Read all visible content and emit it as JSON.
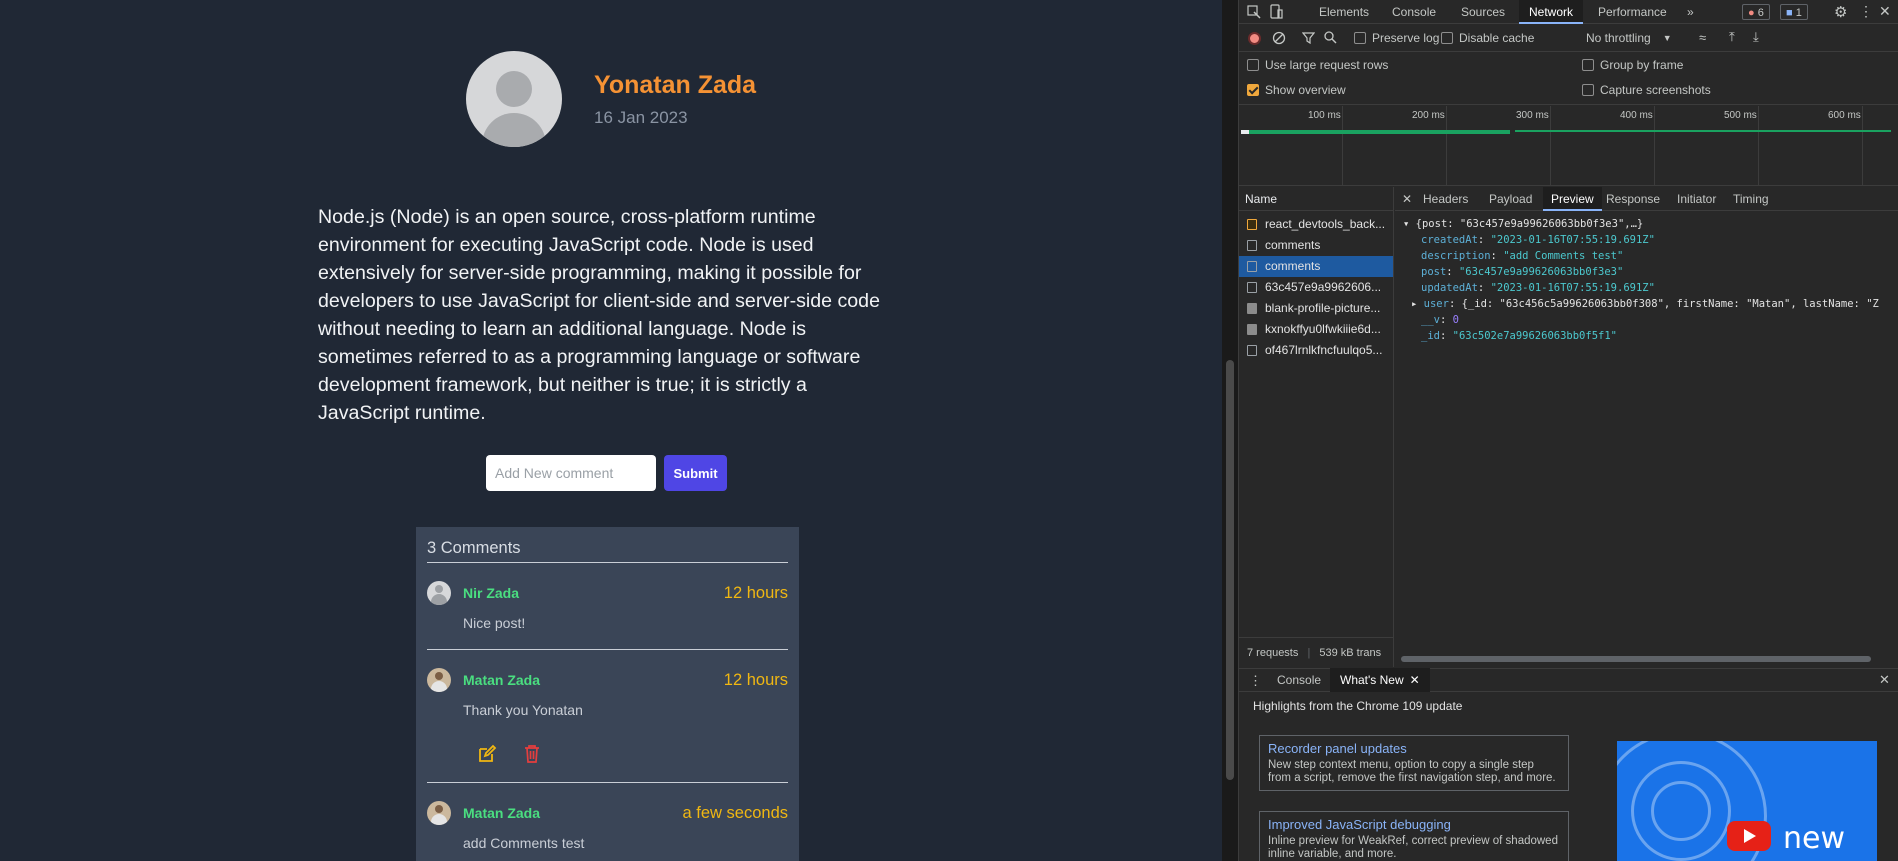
{
  "post": {
    "author": "Yonatan Zada",
    "date": "16 Jan 2023",
    "body": "Node.js (Node) is an open source, cross-platform runtime environment for executing JavaScript code. Node is used extensively for server-side programming, making it possible for developers to use JavaScript for client-side and server-side code without needing to learn an additional language. Node is sometimes referred to as a programming language or software development framework, but neither is true; it is strictly a JavaScript runtime."
  },
  "comment_form": {
    "placeholder": "Add New comment",
    "submit_label": "Submit"
  },
  "comments": {
    "title": "3 Comments",
    "items": [
      {
        "name": "Nir Zada",
        "time": "12 hours",
        "text": "Nice post!"
      },
      {
        "name": "Matan Zada",
        "time": "12 hours",
        "text": "Thank you Yonatan"
      },
      {
        "name": "Matan Zada",
        "time": "a few seconds",
        "text": "add Comments test"
      }
    ]
  },
  "devtools": {
    "tabs": [
      "Elements",
      "Console",
      "Sources",
      "Network",
      "Performance"
    ],
    "more": "»",
    "errors_count": "6",
    "messages_count": "1",
    "toolbar": {
      "preserve_log": "Preserve log",
      "disable_cache": "Disable cache",
      "throttling": "No throttling"
    },
    "options": {
      "large_rows": "Use large request rows",
      "show_overview": "Show overview",
      "group_by_frame": "Group by frame",
      "capture_screenshots": "Capture screenshots"
    },
    "overview_ticks": [
      "100 ms",
      "200 ms",
      "300 ms",
      "400 ms",
      "500 ms",
      "600 ms"
    ],
    "requests_header": "Name",
    "requests": [
      "react_devtools_back...",
      "comments",
      "comments",
      "63c457e9a9962606...",
      "blank-profile-picture...",
      "kxnokffyu0lfwkiiie6d...",
      "of467lrnlkfncfuulqo5..."
    ],
    "status": {
      "requests": "7 requests",
      "transferred": "539 kB trans"
    },
    "preview_tabs": [
      "Headers",
      "Payload",
      "Preview",
      "Response",
      "Initiator",
      "Timing"
    ],
    "json": {
      "root": "{post: \"63c457e9a99626063bb0f3e3\",…}",
      "createdAt_key": "createdAt",
      "createdAt": "\"2023-01-16T07:55:19.691Z\"",
      "description_key": "description",
      "description": "\"add Comments test\"",
      "post_key": "post",
      "post": "\"63c457e9a99626063bb0f3e3\"",
      "updatedAt_key": "updatedAt",
      "updatedAt": "\"2023-01-16T07:55:19.691Z\"",
      "user_key": "user",
      "user": "{_id: \"63c456c5a99626063bb0f308\", firstName: \"Matan\", lastName: \"Z",
      "v_key": "__v",
      "v": "0",
      "id_key": "_id",
      "id": "\"63c502e7a99626063bb0f5f1\""
    },
    "drawer_tabs": [
      "Console",
      "What's New"
    ],
    "whats_new": {
      "highlights": "Highlights from the Chrome 109 update",
      "cards": [
        {
          "title": "Recorder panel updates",
          "desc": "New step context menu, option to copy a single step from a script, remove the first navigation step, and more."
        },
        {
          "title": "Improved JavaScript debugging",
          "desc": "Inline preview for WeakRef, correct preview of shadowed inline variable, and more."
        }
      ],
      "video_label": "new"
    }
  }
}
